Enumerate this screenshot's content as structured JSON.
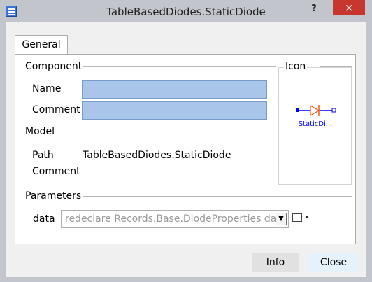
{
  "window": {
    "title": "TableBasedDiodes.StaticDiode",
    "help_label": "?",
    "close_label": "×"
  },
  "tabs": [
    {
      "label": "General",
      "active": true
    }
  ],
  "component": {
    "group_label": "Component",
    "name_label": "Name",
    "name_value": "",
    "comment_label": "Comment",
    "comment_value": ""
  },
  "icon": {
    "group_label": "Icon",
    "caption": "StaticDi...",
    "accent_color": "#0000ff",
    "diode_color": "#ff4d00"
  },
  "model": {
    "group_label": "Model",
    "path_label": "Path",
    "path_value": "TableBasedDiodes.StaticDiode",
    "comment_label": "Comment",
    "comment_value": ""
  },
  "parameters": {
    "group_label": "Parameters",
    "items": [
      {
        "label": "data",
        "value": "redeclare Records.Base.DiodeProperties data"
      }
    ]
  },
  "buttons": {
    "info": "Info",
    "close": "Close"
  }
}
